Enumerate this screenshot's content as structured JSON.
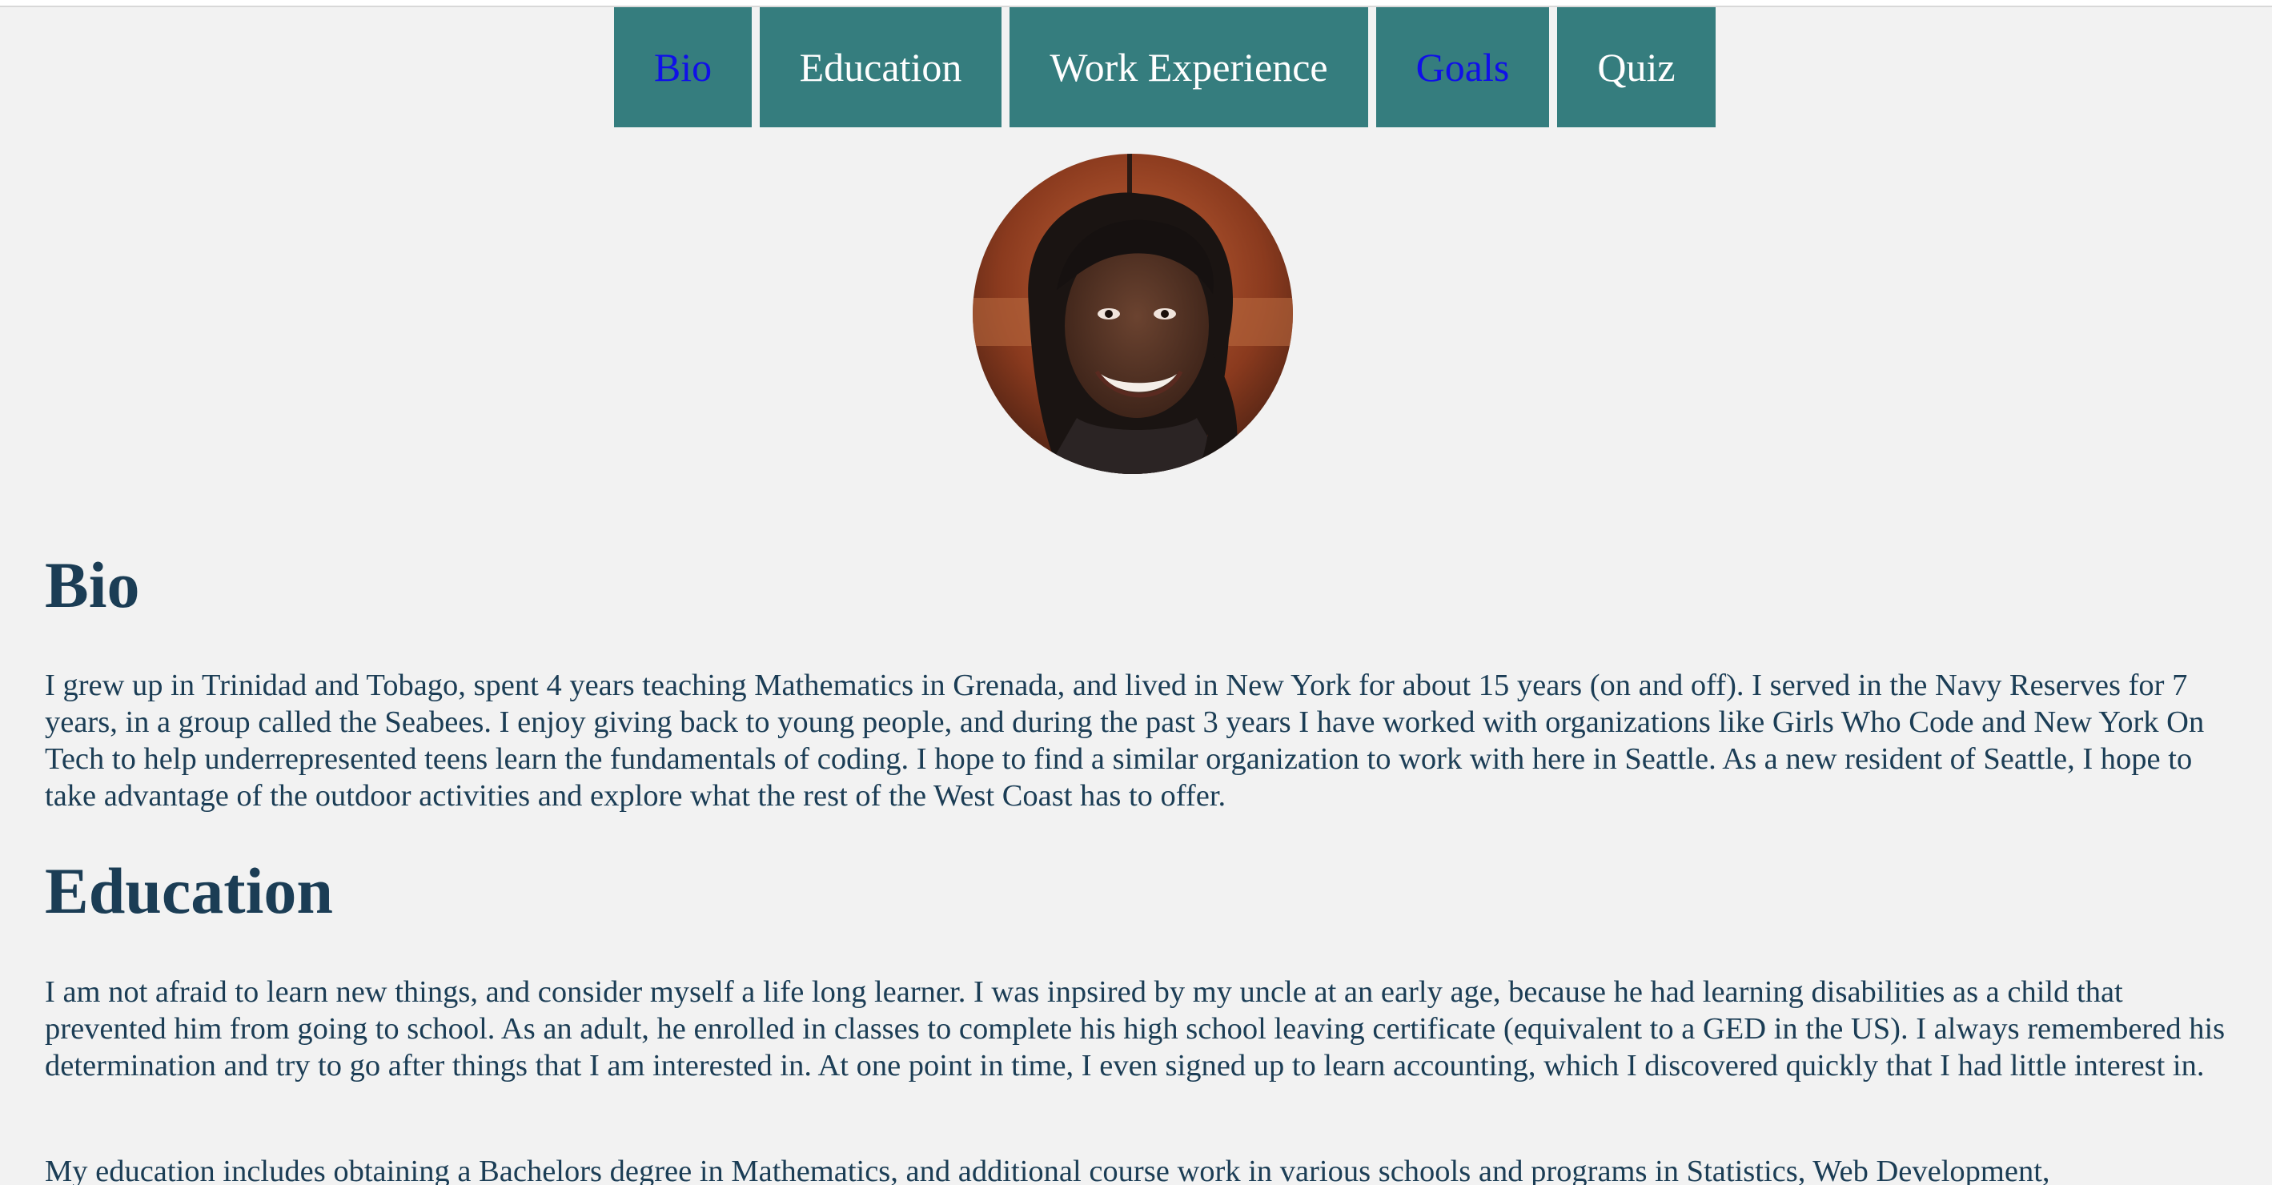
{
  "nav": {
    "items": [
      {
        "label": "Bio"
      },
      {
        "label": "Education"
      },
      {
        "label": "Work Experience"
      },
      {
        "label": "Goals"
      },
      {
        "label": "Quiz"
      }
    ]
  },
  "colors": {
    "nav_background": "#357d7e",
    "nav_text": "#ffffff",
    "nav_link_text": "#1010e8",
    "heading_text": "#1b3d55",
    "page_background": "#f2f2f2"
  },
  "profile": {
    "photo_icon": "profile-photo"
  },
  "sections": {
    "bio": {
      "heading": "Bio",
      "paragraph": "I grew up in Trinidad and Tobago, spent 4 years teaching Mathematics in Grenada, and lived in New York for about 15 years (on and off). I served in the Navy Reserves for 7 years, in a group called the Seabees. I enjoy giving back to young people, and during the past 3 years I have worked with organizations like Girls Who Code and New York On Tech to help underrepresented teens learn the fundamentals of coding. I hope to find a similar organization to work with here in Seattle. As a new resident of Seattle, I hope to take advantage of the outdoor activities and explore what the rest of the West Coast has to offer."
    },
    "education": {
      "heading": "Education",
      "paragraph1": "I am not afraid to learn new things, and consider myself a life long learner. I was inpsired by my uncle at an early age, because he had learning disabilities as a child that prevented him from going to school. As an adult, he enrolled in classes to complete his high school leaving certificate (equivalent to a GED in the US). I always remembered his determination and try to go after things that I am interested in. At one point in time, I even signed up to learn accounting, which I discovered quickly that I had little interest in.",
      "paragraph2": "My education includes obtaining a Bachelors degree in Mathematics, and additional course work in various schools and programs in Statistics, Web Development,"
    }
  }
}
